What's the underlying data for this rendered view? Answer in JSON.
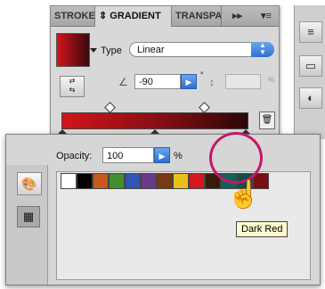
{
  "gradient_panel": {
    "tabs": [
      "STROKE",
      "GRADIENT",
      "TRANSPARENCY"
    ],
    "overflow_label": "▸▸",
    "menu_label": "▾≡",
    "type_label": "Type",
    "type_value": "Linear",
    "angle_value": "-90",
    "degree_symbol": "°",
    "aspect_percent": "%"
  },
  "swatches_panel": {
    "opacity_label": "Opacity:",
    "opacity_value": "100",
    "opacity_unit": "%",
    "swatches": [
      {
        "name": "White",
        "color": "#ffffff"
      },
      {
        "name": "Black",
        "color": "#000000"
      },
      {
        "name": "Orange-Brown",
        "color": "#c55a1a"
      },
      {
        "name": "Green",
        "color": "#3f8f2f"
      },
      {
        "name": "Blue",
        "color": "#2e56b4"
      },
      {
        "name": "Purple",
        "color": "#6a3a8a"
      },
      {
        "name": "Brown",
        "color": "#7a3a10"
      },
      {
        "name": "Yellow",
        "color": "#e8c21a"
      },
      {
        "name": "Red",
        "color": "#d41820"
      },
      {
        "name": "Dark Brown",
        "color": "#3a1a0a"
      },
      {
        "name": "Teal",
        "color": "#16605a"
      },
      {
        "name": "Dark Teal",
        "color": "#0f5048"
      },
      {
        "name": "Dark Red",
        "color": "#7a0f14"
      }
    ],
    "tooltip": "Dark Red"
  },
  "colors": {
    "highlight": "#c2186a",
    "accent_blue": "#2e6fd0"
  }
}
